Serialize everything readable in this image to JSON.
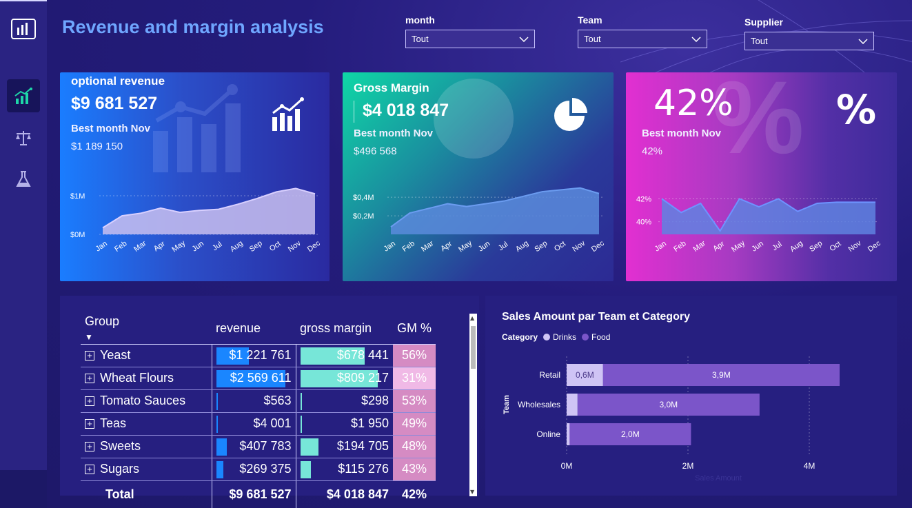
{
  "title": "Revenue and margin analysis",
  "filters": [
    {
      "label": "month",
      "value": "Tout"
    },
    {
      "label": "Team",
      "value": "Tout"
    },
    {
      "label": "Supplier",
      "value": "Tout"
    }
  ],
  "cards": {
    "revenue": {
      "title": "optional revenue",
      "value": "$9 681 527",
      "best_label": "Best month Nov",
      "best_value": "$1 189 150",
      "y_ticks": [
        "$1M",
        "$0M"
      ],
      "months": [
        "Jan",
        "Feb",
        "Mar",
        "Apr",
        "May",
        "Jun",
        "Jul",
        "Aug",
        "Sep",
        "Oct",
        "Nov",
        "Dec"
      ],
      "series": [
        0.17,
        0.48,
        0.55,
        0.68,
        0.57,
        0.62,
        0.65,
        0.78,
        0.93,
        1.1,
        1.19,
        1.05
      ]
    },
    "margin": {
      "title": "Gross Margin",
      "value": "$4 018 847",
      "best_label": "Best month Nov",
      "best_value": "$496 568",
      "y_ticks": [
        "$0,4M",
        "$0,2M"
      ],
      "months": [
        "Jan",
        "Feb",
        "Mar",
        "Apr",
        "May",
        "Jun",
        "Jul",
        "Aug",
        "Sep",
        "Oct",
        "Nov",
        "Dec"
      ],
      "series": [
        0.08,
        0.23,
        0.28,
        0.33,
        0.3,
        0.33,
        0.36,
        0.41,
        0.46,
        0.48,
        0.5,
        0.44
      ]
    },
    "pct": {
      "big": "42%",
      "best_label": "Best month Nov",
      "best_value": "42%",
      "y_ticks": [
        "42%",
        "40%"
      ],
      "months": [
        "Jan",
        "Feb",
        "Mar",
        "Apr",
        "May",
        "Jun",
        "Jul",
        "Aug",
        "Sep",
        "Oct",
        "Nov",
        "Dec"
      ],
      "series": [
        42.0,
        40.8,
        41.6,
        39.2,
        42.0,
        41.3,
        42.0,
        40.9,
        41.6,
        41.7,
        41.7,
        41.7
      ]
    }
  },
  "table": {
    "headers": [
      "Group",
      "revenue",
      "gross margin",
      "GM %"
    ],
    "rows": [
      {
        "group": "Yeast",
        "revenue": "$1 221 761",
        "rev": 1221761,
        "margin": "$678 441",
        "gm": 678441,
        "pct": "56%"
      },
      {
        "group": "Wheat Flours",
        "revenue": "$2 569 611",
        "rev": 2569611,
        "margin": "$809 217",
        "gm": 809217,
        "pct": "31%"
      },
      {
        "group": "Tomato Sauces",
        "revenue": "$563",
        "rev": 563,
        "margin": "$298",
        "gm": 298,
        "pct": "53%"
      },
      {
        "group": "Teas",
        "revenue": "$4 001",
        "rev": 4001,
        "margin": "$1 950",
        "gm": 1950,
        "pct": "49%"
      },
      {
        "group": "Sweets",
        "revenue": "$407 783",
        "rev": 407783,
        "margin": "$194 705",
        "gm": 194705,
        "pct": "48%"
      },
      {
        "group": "Sugars",
        "revenue": "$269 375",
        "rev": 269375,
        "margin": "$115 276",
        "gm": 115276,
        "pct": "43%"
      }
    ],
    "total": {
      "label": "Total",
      "revenue": "$9 681 527",
      "margin": "$4 018 847",
      "pct": "42%"
    }
  },
  "chart_data": {
    "type": "bar",
    "orientation": "horizontal-stacked",
    "title": "Sales Amount par Team et Category",
    "legend_title": "Category",
    "legend": [
      "Drinks",
      "Food"
    ],
    "ylabel": "Team",
    "xlabel": "Sales Amount",
    "categories": [
      "Retail",
      "Wholesales",
      "Online"
    ],
    "series": [
      {
        "name": "Drinks",
        "values": [
          0.6,
          0.18,
          0.05
        ],
        "labels": [
          "0,6M",
          "",
          ""
        ],
        "color": "#cfc4f5"
      },
      {
        "name": "Food",
        "values": [
          3.9,
          3.0,
          2.0
        ],
        "labels": [
          "3,9M",
          "3,0M",
          "2,0M"
        ],
        "color": "#7b55c9"
      }
    ],
    "xticks": [
      "0M",
      "2M",
      "4M"
    ],
    "xlim": [
      0,
      5
    ],
    "grid": true
  },
  "colors": {
    "accent": "#6fa6ff",
    "revenue_bar": "#1a86ff",
    "margin_bar": "#77e6d8",
    "pct_cell": "#d58bc3"
  }
}
